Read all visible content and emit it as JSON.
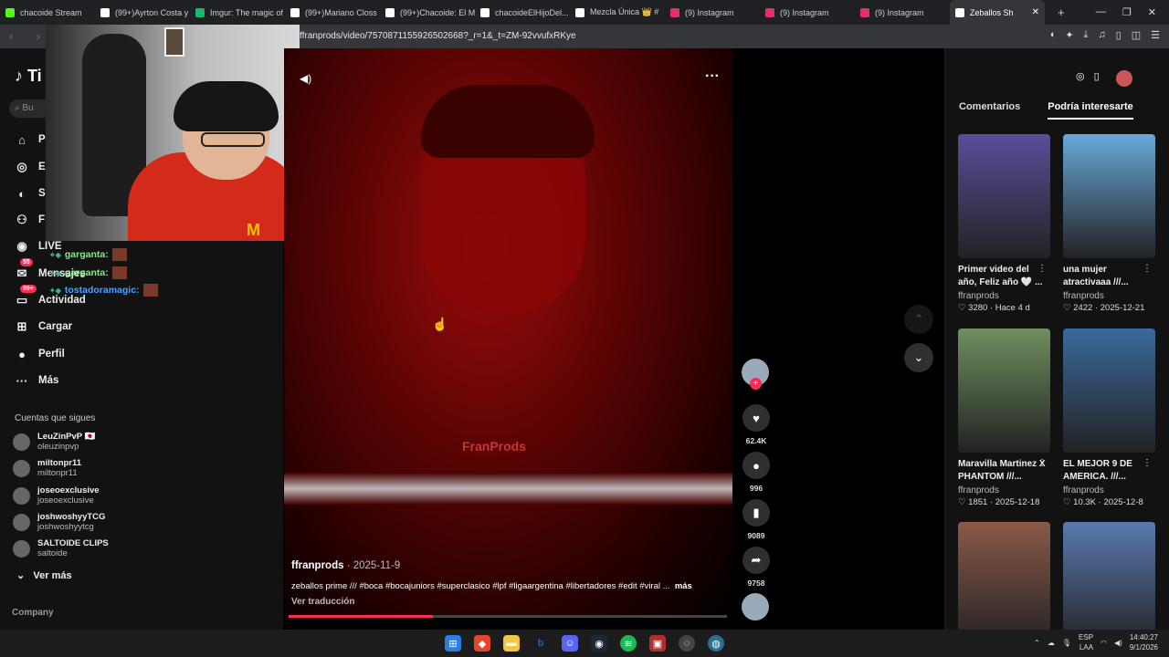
{
  "browser": {
    "tabs": [
      {
        "title": "chacoide Stream",
        "color": "#53fc18"
      },
      {
        "title": "(99+)Ayrton Costa y",
        "color": "#ffffff"
      },
      {
        "title": "Imgur: The magic of",
        "color": "#1bb76e"
      },
      {
        "title": "(99+)Mariano Closs",
        "color": "#ffffff"
      },
      {
        "title": "(99+)Chacoide: El M",
        "color": "#ffffff"
      },
      {
        "title": "chacoideElHijoDel...",
        "color": "#ffffff"
      },
      {
        "title": "Mezcla Única 👑 #",
        "color": "#ffffff"
      },
      {
        "title": "(9) Instagram",
        "color": "#e1306c"
      },
      {
        "title": "(9) Instagram",
        "color": "#e1306c"
      },
      {
        "title": "(9) Instagram",
        "color": "#e1306c"
      },
      {
        "title": "Zeballos Sh",
        "color": "#ffffff"
      }
    ],
    "url": "ffranprods/video/7570871155926502668?_r=1&_t=ZM-92vvufxRKye"
  },
  "sidebar": {
    "logo": "Ti",
    "search_placeholder": "Bu",
    "nav": [
      {
        "label": "P",
        "icon": "home-icon"
      },
      {
        "label": "E",
        "icon": "explore-icon"
      },
      {
        "label": "S",
        "icon": "following-icon"
      },
      {
        "label": "F",
        "icon": "friends-icon"
      },
      {
        "label": "LIVE",
        "icon": "live-icon"
      },
      {
        "label": "Mensajes",
        "icon": "messages-icon",
        "badge": "55"
      },
      {
        "label": "Actividad",
        "icon": "activity-icon",
        "badge": "99+"
      },
      {
        "label": "Cargar",
        "icon": "upload-icon"
      },
      {
        "label": "Perfil",
        "icon": "profile-icon"
      },
      {
        "label": "Más",
        "icon": "more-icon"
      }
    ],
    "following_title": "Cuentas que sigues",
    "accounts": [
      {
        "name": "LeuZinPvP 🇯🇵",
        "handle": "oleuzinpvp"
      },
      {
        "name": "miltonpr11",
        "handle": "miltonpr11"
      },
      {
        "name": "joseoexclusive",
        "handle": "joseoexclusive"
      },
      {
        "name": "joshwoshyyTCG",
        "handle": "joshwoshyytcg"
      },
      {
        "name": "SALTOIDE CLIPS",
        "handle": "saltoide"
      }
    ],
    "see_more": "Ver más",
    "company": "Company"
  },
  "chat": [
    {
      "user": "garganta:",
      "color": "#7cf27c"
    },
    {
      "user": "garganta:",
      "color": "#7cf27c"
    },
    {
      "user": "tostadoramagic:",
      "color": "#4aa3ff"
    }
  ],
  "webcam": {
    "logo": "M"
  },
  "video": {
    "watermark": "FranProds",
    "author": "ffranprods",
    "date": "· 2025-11-9",
    "description": "zeballos prime /// #boca #bocajuniors #superclasico #lpf #ligaargentina #libertadores #edit #viral ...",
    "more_label": "más",
    "translate_label": "Ver traducción",
    "progress": 0.33,
    "likes": "62.4K",
    "comments": "996",
    "saves": "9089",
    "shares": "9758"
  },
  "right_panel": {
    "tabs": [
      "Comentarios",
      "Podría interesarte"
    ],
    "cards": [
      {
        "title": "Primer video del año, Feliz año 🤍 ...",
        "author": "ffranprods",
        "likes": "3280",
        "date": "Hace 4 d",
        "thumb": "#5a4e9a"
      },
      {
        "title": "una mujer atractivaaa ///...",
        "author": "ffranprods",
        "likes": "2422",
        "date": "2025-12-21",
        "thumb": "#6aa8d8"
      },
      {
        "title": "Maravilla Martinez X PHANTOM ///...",
        "author": "ffranprods",
        "likes": "1851",
        "date": "2025-12-18",
        "thumb": "#6f8f5f"
      },
      {
        "title": "EL MEJOR 9 DE AMERICA. ///...",
        "author": "ffranprods",
        "likes": "10.3K",
        "date": "2025-12-8",
        "thumb": "#3a6a9a"
      },
      {
        "title": "",
        "author": "",
        "likes": "",
        "date": "",
        "thumb": "#8a5a4a"
      },
      {
        "title": "",
        "author": "",
        "likes": "",
        "date": "",
        "thumb": "#5a7ab0"
      }
    ]
  },
  "taskbar": {
    "lang": "ESP",
    "region": "LAA",
    "time": "14:40:27",
    "date": "9/1/2026"
  }
}
